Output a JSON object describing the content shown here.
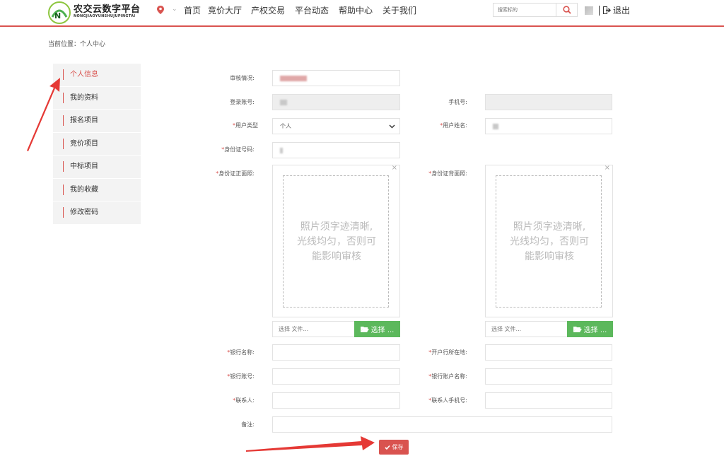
{
  "header": {
    "logo_title": "农交云数字平台",
    "logo_subtitle": "NONGJIAOYUNSHUJUPINGTAI",
    "nav": [
      "首页",
      "竞价大厅",
      "产权交易",
      "平台动态",
      "帮助中心",
      "关于我们"
    ],
    "search_placeholder": "搜索标的",
    "logout_label": "退出",
    "accent_color": "#d9534f"
  },
  "breadcrumb": "当前位置：个人中心",
  "sidebar": {
    "items": [
      {
        "label": "个人信息",
        "active": true
      },
      {
        "label": "我的资料",
        "active": false
      },
      {
        "label": "报名项目",
        "active": false
      },
      {
        "label": "竞价项目",
        "active": false
      },
      {
        "label": "中标项目",
        "active": false
      },
      {
        "label": "我的收藏",
        "active": false
      },
      {
        "label": "修改密码",
        "active": false
      }
    ]
  },
  "form": {
    "audit_status_label": "审核情况:",
    "login_account_label": "登录账号:",
    "phone_label": "手机号:",
    "user_type_label": "用户类型",
    "user_type_value": "个人",
    "user_name_label": "用户姓名:",
    "id_number_label": "身份证号码:",
    "id_front_label": "身份证正面照:",
    "id_back_label": "身份证背面照:",
    "upload_hint_line1": "照片须字迹清晰,",
    "upload_hint_line2": "光线均匀，否则可",
    "upload_hint_line3": "能影响审核",
    "file_placeholder": "选择 文件...",
    "file_button": "选择 ...",
    "bank_name_label": "银行名称:",
    "bank_location_label": "开户行所在地:",
    "bank_account_label": "银行账号:",
    "bank_account_name_label": "银行账户名称:",
    "contact_label": "联系人:",
    "contact_phone_label": "联系人手机号:",
    "remark_label": "备注:",
    "required_mark": "*",
    "save_label": "保存"
  }
}
